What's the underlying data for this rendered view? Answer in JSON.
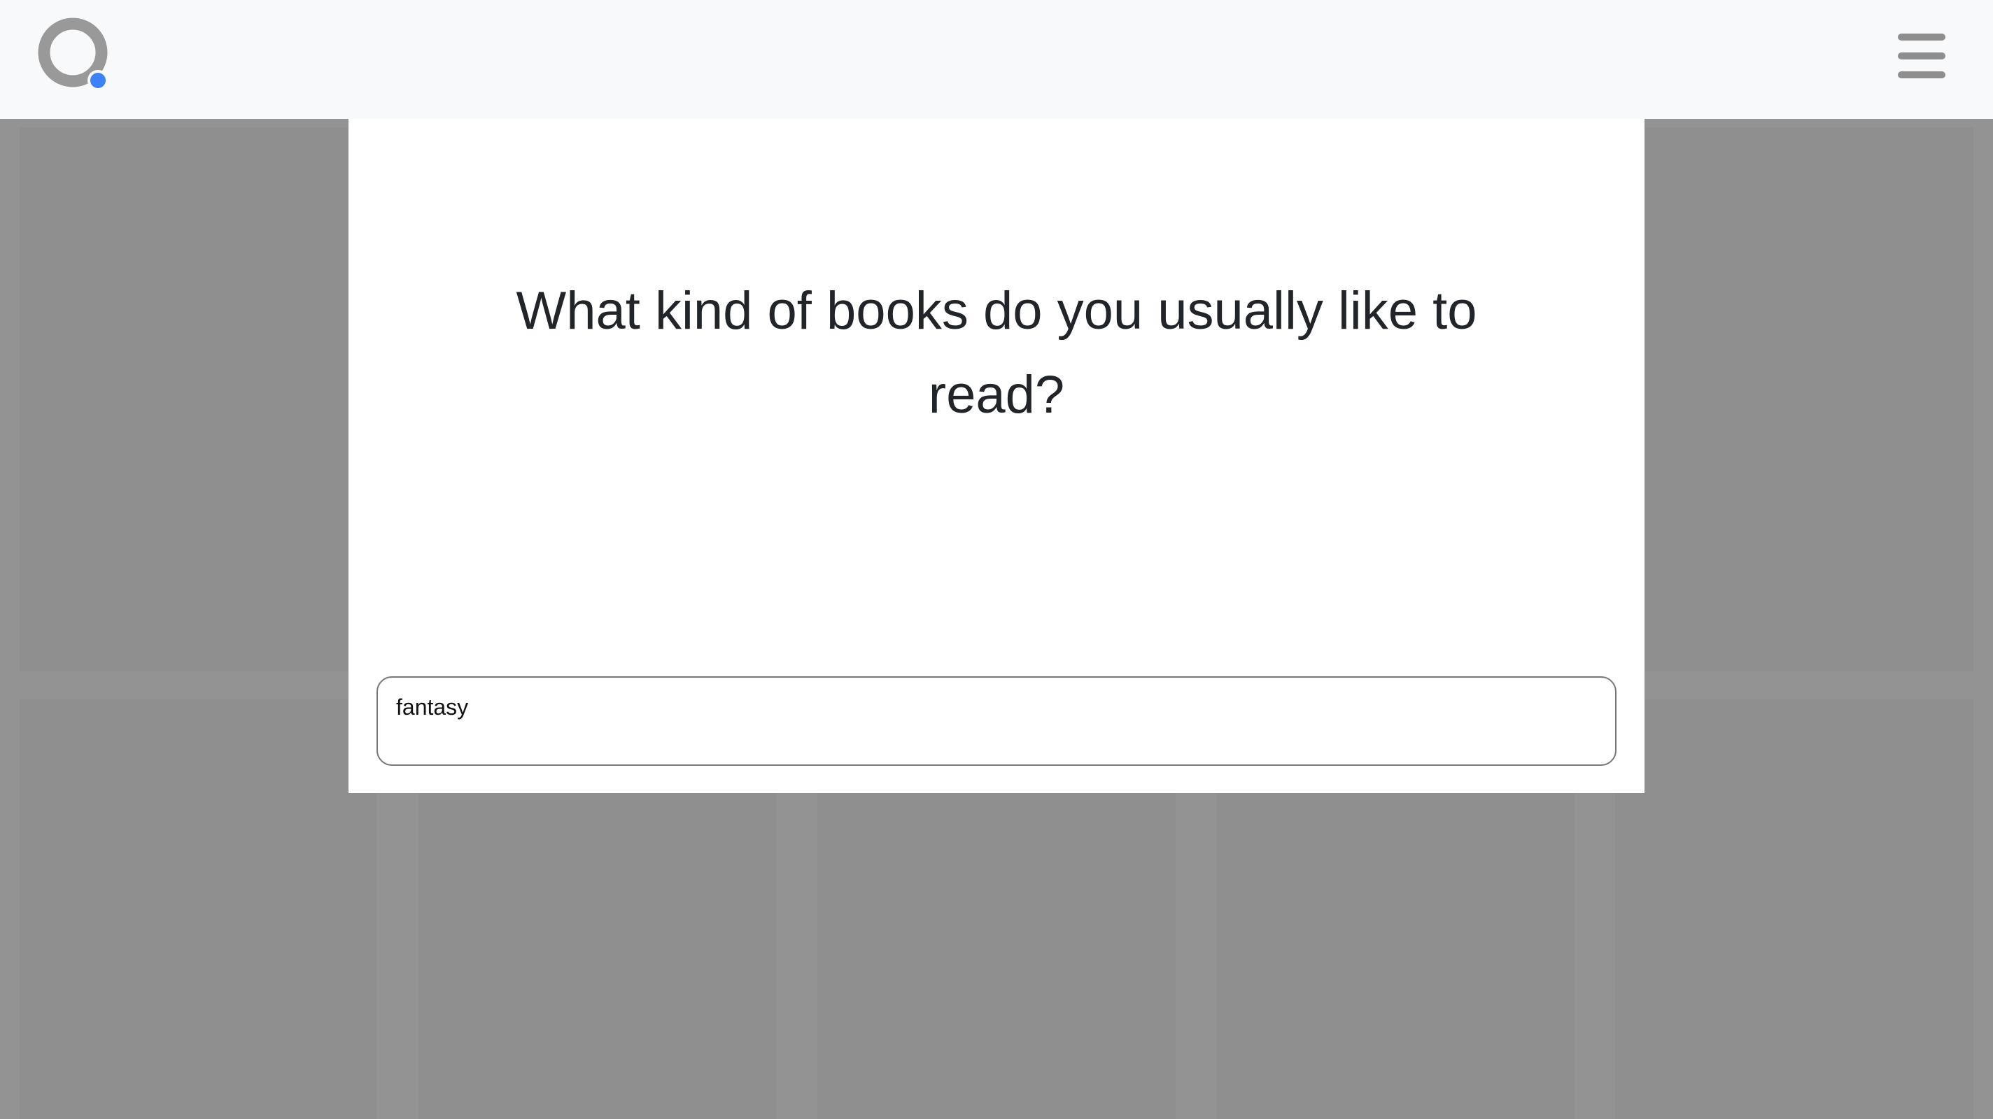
{
  "header": {
    "logo_icon": "search-logo-icon",
    "menu_icon": "hamburger-menu-icon",
    "accent_color": "#3b82f6",
    "logo_color": "#999999"
  },
  "modal": {
    "question": "What kind of books do you usually like to read?",
    "answer_value": "fantasy"
  }
}
